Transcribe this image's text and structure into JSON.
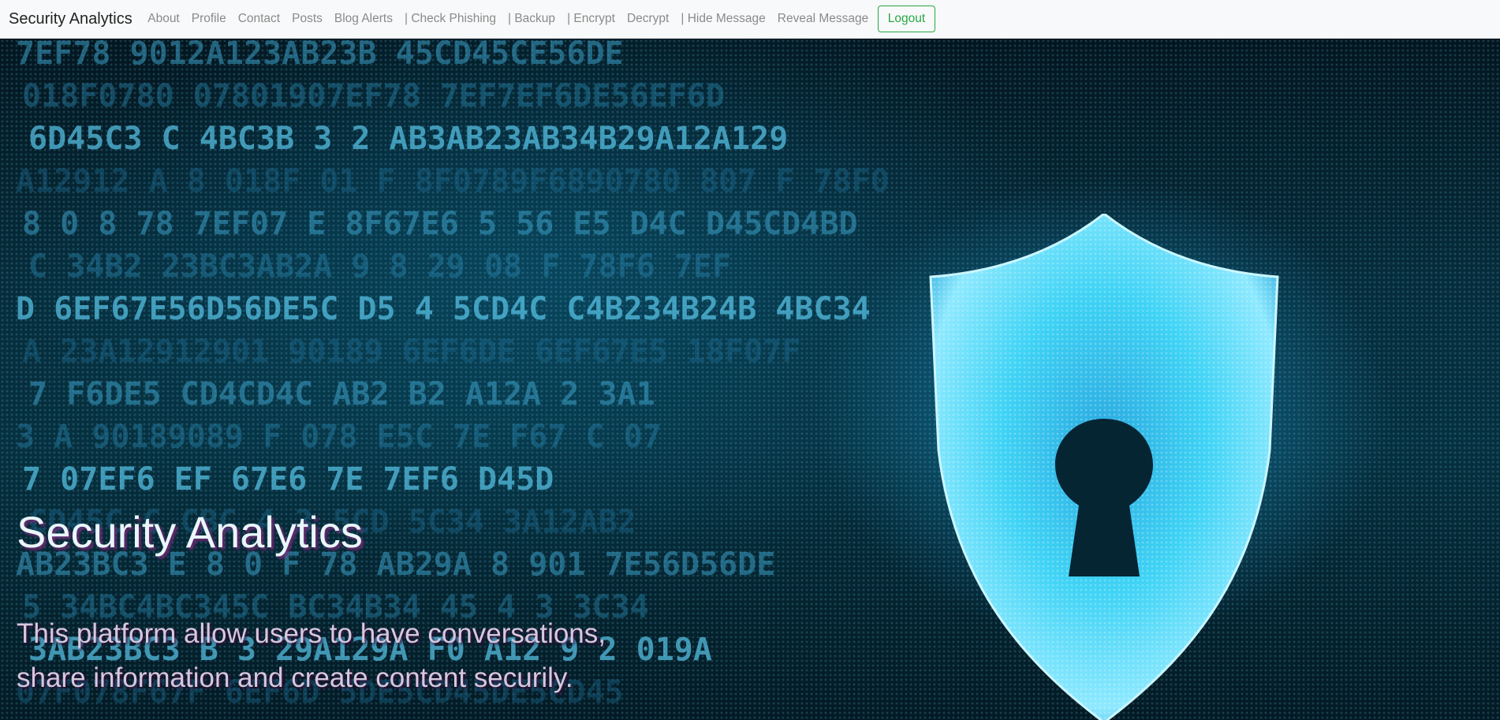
{
  "navbar": {
    "brand": "Security Analytics",
    "links": [
      "About",
      "Profile",
      "Contact",
      "Posts",
      "Blog Alerts",
      "| Check Phishing",
      "| Backup",
      "| Encrypt",
      "Decrypt",
      "| Hide Message",
      "Reveal Message"
    ],
    "logout_label": "Logout"
  },
  "hero": {
    "title": "Security Analytics",
    "subtitle": "This platform allow users to have conversations, share information and create content securily.",
    "image_icon": "shield-lock-icon",
    "code_text": [
      "7EF78 9012A123AB23B 45CD45CE56DE",
      "018F0780 07801907EF78 7EF7EF6DE56EF6D",
      "6D45C3 C 4BC3B 3 2 AB3AB23AB34B29A12A129",
      "A12912 A 8 018F 01 F 8F0789F6890780 807 F 78F0",
      "8 0 8 78 7EF07 E 8F67E6 5 56 E5 D4C D45CD4BD",
      "C 34B2 23BC3AB2A 9 8 29 08 F 78F6 7EF",
      "D 6EF67E56D56DE5C D5 4 5CD4C C4B234B24B 4BC34",
      "A 23A12912901 90189 6EF6DE 6EF67E5 18F07F",
      "7 F6DE5 CD4CD4C AB2 B2 A12A 2 3A1",
      "3 A 90189089 F 078 E5C 7E F67 C 07",
      "7 07EF6 EF 67E6 7E 7EF6 D45D",
      "CD45C C CBC 4 3 5CD 5C34 3A12AB2",
      "AB23BC3 E 8 0 F 78 AB29A 8 901 7E56D56DE",
      "5 34BC4BC345C BC34B34 45 4 3 3C34",
      "3AB23BC3 B 3 29A129A F0 A12 9 2 019A",
      "07F078F67F 6EF6D 5DE5CD45DE5CD45"
    ]
  },
  "colors": {
    "navbar_bg": "#f8f9fa",
    "logout": "#28a745",
    "hero_title": "#e9f6fa",
    "hero_subtitle": "#d6c8dd",
    "shield": "#3fd3f5"
  }
}
